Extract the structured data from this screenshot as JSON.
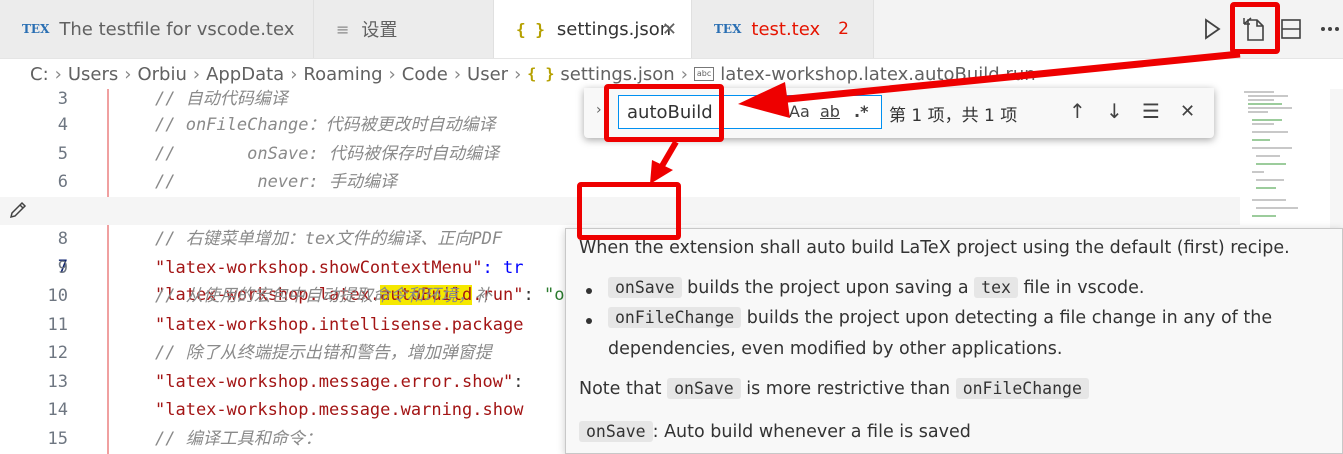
{
  "tabs": [
    {
      "label": "The testfile for vscode.tex",
      "icon": "tex-icon"
    },
    {
      "label": "设置",
      "icon": "settings-file-icon"
    },
    {
      "label": "settings.json",
      "icon": "json-braces-icon",
      "close": "✕"
    },
    {
      "label": "test.tex",
      "icon": "tex-icon",
      "badge": "2"
    }
  ],
  "tex_icon_text": "TEX",
  "braces": "{ }",
  "breadcrumb": [
    "C:",
    "Users",
    "Orbiu",
    "AppData",
    "Roaming",
    "Code",
    "User",
    "settings.json",
    "latex-workshop.latex.autoBuild.run"
  ],
  "breadcrumb_sep": "›",
  "editor": {
    "lines": [
      {
        "num": "3",
        "text": "// 自动代码编译"
      },
      {
        "num": "4",
        "text": "// onFileChange：代码被更改时自动编译"
      },
      {
        "num": "5",
        "text": "//       onSave: 代码被保存时自动编译"
      },
      {
        "num": "6",
        "text": "//        never: 手动编译"
      },
      {
        "num": "7",
        "key_pre": "\"latex-workshop.latex.",
        "key_hl": "autoBuild",
        "key_post": ".run\"",
        "colon": ":",
        "value": "\"onSave\"",
        "comma": ","
      },
      {
        "num": "8",
        "text": "// 右键菜单增加：tex文件的编译、正向PDF"
      },
      {
        "num": "9",
        "key": "\"latex-workshop.showContextMenu\"",
        "rest": ": tr"
      },
      {
        "num": "10",
        "text": "// 从使用的宏包中自动提取命令和环境，补"
      },
      {
        "num": "11",
        "key": "\"latex-workshop.intellisense.package"
      },
      {
        "num": "12",
        "text": "// 除了从终端提示出错和警告，增加弹窗提"
      },
      {
        "num": "13",
        "key": "\"latex-workshop.message.error.show\"",
        "rest": ":"
      },
      {
        "num": "14",
        "key": "\"latex-workshop.message.warning.show"
      },
      {
        "num": "15",
        "text": "// 编译工具和命令："
      }
    ]
  },
  "find": {
    "value": "autoBuild",
    "match_case": "Aa",
    "whole_word": "ab",
    "regex": ".*",
    "result": "第 1 项，共 1 项",
    "prev": "↑",
    "next": "↓",
    "selection": "☰",
    "close": "✕",
    "toggle": "›"
  },
  "hover": {
    "line1": "When the extension shall auto build LaTeX project using the default (first) recipe.",
    "b1_code": "onSave",
    "b1_a": " builds the project upon saving a ",
    "b1_code2": "tex",
    "b1_b": " file in vscode.",
    "b2_code": "onFileChange",
    "b2_a": " builds the project upon detecting a file change in any of the",
    "b2_b": "dependencies, even modified by other applications.",
    "note_a": "Note that ",
    "note_code": "onSave",
    "note_b": " is more restrictive than ",
    "note_code2": "onFileChange",
    "last_code": "onSave",
    "last_text": ": Auto build whenever a file is saved"
  },
  "colors": {
    "annotation": "#ee0000",
    "highlight": "#f5e800",
    "string": "#a31515",
    "value": "#2a7b2e"
  }
}
